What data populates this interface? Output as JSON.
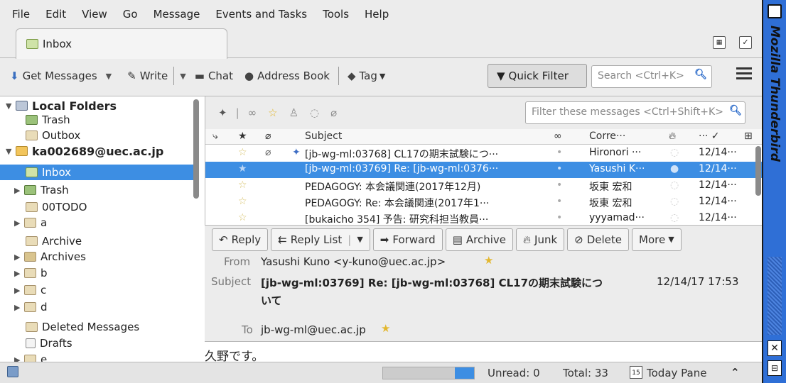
{
  "menubar": {
    "items": [
      "File",
      "Edit",
      "View",
      "Go",
      "Message",
      "Events and Tasks",
      "Tools",
      "Help"
    ]
  },
  "tabs": [
    {
      "label": "Inbox"
    }
  ],
  "toolbar": {
    "get_messages": "Get Messages",
    "write": "Write",
    "chat": "Chat",
    "address_book": "Address Book",
    "tag": "Tag",
    "quick_filter": "Quick Filter",
    "search_placeholder": "Search <Ctrl+K>"
  },
  "folders": [
    {
      "label": "Local Folders"
    },
    {
      "label": "Trash"
    },
    {
      "label": "Outbox"
    },
    {
      "label": "ka002689@uec.ac.jp"
    },
    {
      "label": "Inbox"
    },
    {
      "label": "Trash"
    },
    {
      "label": "00TODO"
    },
    {
      "label": "a"
    },
    {
      "label": "Archive"
    },
    {
      "label": "Archives"
    },
    {
      "label": "b"
    },
    {
      "label": "c"
    },
    {
      "label": "d"
    },
    {
      "label": "Deleted Messages"
    },
    {
      "label": "Drafts"
    },
    {
      "label": "e"
    }
  ],
  "filter": {
    "placeholder": "Filter these messages <Ctrl+Shift+K>"
  },
  "columns": {
    "subject": "Subject",
    "correspondent": "Corre···",
    "date": "··· ✓"
  },
  "messages": [
    {
      "subject": "[jb-wg-ml:03768] CL17の期末試験につ···",
      "correspondent": "Hironori ···",
      "date": "12/14···"
    },
    {
      "subject": "[jb-wg-ml:03769] Re: [jb-wg-ml:0376···",
      "correspondent": "Yasushi K···",
      "date": "12/14···"
    },
    {
      "subject": "PEDAGOGY: 本会議関連(2017年12月)",
      "correspondent": "坂東 宏和",
      "date": "12/14···"
    },
    {
      "subject": "PEDAGOGY: Re: 本会議関連(2017年1···",
      "correspondent": "坂東 宏和",
      "date": "12/14···"
    },
    {
      "subject": "[bukaicho 354] 予告: 研究科担当教員···",
      "correspondent": "yyyamad···",
      "date": "12/14···"
    }
  ],
  "header_toolbar": {
    "reply": "Reply",
    "reply_list": "Reply List",
    "forward": "Forward",
    "archive": "Archive",
    "junk": "Junk",
    "delete": "Delete",
    "more": "More"
  },
  "message": {
    "from_label": "From",
    "from": "Yasushi Kuno <y-kuno@uec.ac.jp>",
    "subject_label": "Subject",
    "subject_line1": "[jb-wg-ml:03769] Re: [jb-wg-ml:03768] CL17の期末試験につ",
    "subject_line2": "いて",
    "date": "12/14/17 17:53",
    "to_label": "To",
    "to": "jb-wg-ml@uec.ac.jp",
    "body_preview": "久野です。"
  },
  "statusbar": {
    "unread": "Unread: 0",
    "total": "Total: 33",
    "today_pane": "Today Pane",
    "today_day": "15"
  },
  "wm": {
    "title": "Mozilla Thunderbird"
  },
  "colors": {
    "selection": "#3d8ee3",
    "wm_bar": "#2f6fd6"
  }
}
